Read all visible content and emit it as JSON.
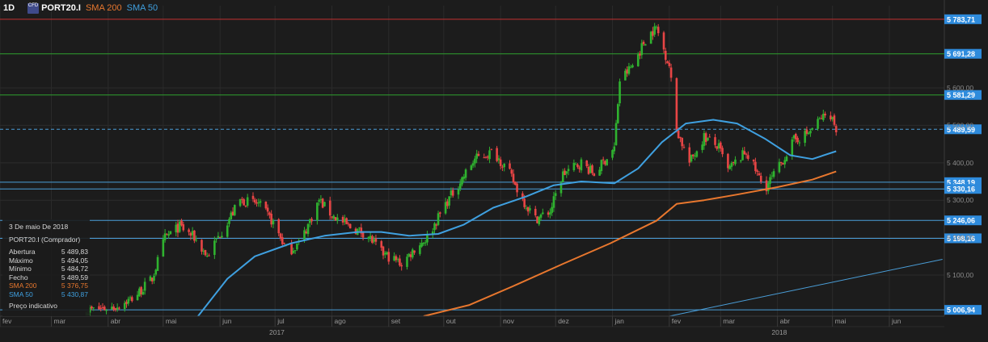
{
  "header": {
    "timeframe": "1D",
    "badge": "CFD",
    "symbol": "PORT20.I",
    "sma200_label": "SMA 200",
    "sma50_label": "SMA 50"
  },
  "colors": {
    "background": "#1c1c1c",
    "sma200": "#e8772e",
    "sma50": "#3fa0e0",
    "candle_up": "#2fb22f",
    "candle_down": "#e84545",
    "level_red": "#c43030",
    "level_green": "#2ea02e",
    "level_blue": "#4a9ed8",
    "label_bg": "#2e8bdc"
  },
  "info_panel": {
    "date": "3 De maio De 2018",
    "instrument": "PORT20.I (Comprador)",
    "open_label": "Abertura",
    "open": "5 489,83",
    "high_label": "Máximo",
    "high": "5 494,05",
    "low_label": "Mínimo",
    "low": "5 484,72",
    "close_label": "Fecho",
    "close": "5 489,59",
    "sma200_label": "SMA 200",
    "sma200": "5 376,75",
    "sma50_label": "SMA 50",
    "sma50": "5 430,87",
    "note": "Preço indicativo"
  },
  "chart_data": {
    "type": "candlestick",
    "symbol": "PORT20.I",
    "timeframe": "1D",
    "ylim": [
      4990,
      5820
    ],
    "y_ticks": [
      5100,
      5200,
      5300,
      5400,
      5500,
      5600
    ],
    "y_tick_labels": [
      "5 100,00",
      "5 200,00",
      "5 300,00",
      "5 400,00",
      "5 500,00",
      "5 600,00"
    ],
    "x_months": [
      "fev",
      "mar",
      "abr",
      "mai",
      "jun",
      "jul",
      "ago",
      "set",
      "out",
      "nov",
      "dez",
      "jan",
      "fev",
      "mar",
      "abr",
      "mai",
      "jun"
    ],
    "x_years": [
      "2017",
      "2018"
    ],
    "price_levels": [
      {
        "value": 5783.71,
        "label": "5 783,71",
        "color": "red"
      },
      {
        "value": 5691.28,
        "label": "5 691,28",
        "color": "green"
      },
      {
        "value": 5581.29,
        "label": "5 581,29",
        "color": "green"
      },
      {
        "value": 5489.59,
        "label": "5 489,59",
        "color": "blue",
        "style": "dashed"
      },
      {
        "value": 5348.19,
        "label": "5 348,19",
        "color": "blue"
      },
      {
        "value": 5330.16,
        "label": "5 330,16",
        "color": "blue"
      },
      {
        "value": 5246.06,
        "label": "5 246,06",
        "color": "blue"
      },
      {
        "value": 5198.16,
        "label": "5 198,16",
        "color": "blue"
      },
      {
        "value": 5006.94,
        "label": "5 006,94",
        "color": "blue"
      }
    ],
    "close_path": [
      [
        "2017-03-20",
        5005
      ],
      [
        "2017-04-05",
        5015
      ],
      [
        "2017-04-15",
        5040
      ],
      [
        "2017-04-25",
        5090
      ],
      [
        "2017-05-02",
        5200
      ],
      [
        "2017-05-10",
        5230
      ],
      [
        "2017-05-18",
        5200
      ],
      [
        "2017-05-25",
        5150
      ],
      [
        "2017-06-01",
        5210
      ],
      [
        "2017-06-12",
        5300
      ],
      [
        "2017-06-22",
        5290
      ],
      [
        "2017-06-30",
        5240
      ],
      [
        "2017-07-08",
        5160
      ],
      [
        "2017-07-15",
        5190
      ],
      [
        "2017-07-25",
        5300
      ],
      [
        "2017-08-01",
        5260
      ],
      [
        "2017-08-10",
        5230
      ],
      [
        "2017-08-20",
        5210
      ],
      [
        "2017-08-28",
        5160
      ],
      [
        "2017-09-08",
        5130
      ],
      [
        "2017-09-15",
        5170
      ],
      [
        "2017-09-22",
        5200
      ],
      [
        "2017-10-02",
        5290
      ],
      [
        "2017-10-10",
        5350
      ],
      [
        "2017-10-18",
        5410
      ],
      [
        "2017-10-28",
        5430
      ],
      [
        "2017-11-05",
        5380
      ],
      [
        "2017-11-12",
        5310
      ],
      [
        "2017-11-20",
        5250
      ],
      [
        "2017-11-28",
        5270
      ],
      [
        "2017-12-05",
        5370
      ],
      [
        "2017-12-15",
        5400
      ],
      [
        "2017-12-22",
        5370
      ],
      [
        "2018-01-02",
        5440
      ],
      [
        "2018-01-05",
        5620
      ],
      [
        "2018-01-12",
        5660
      ],
      [
        "2018-01-20",
        5740
      ],
      [
        "2018-01-25",
        5760
      ],
      [
        "2018-02-01",
        5660
      ],
      [
        "2018-02-05",
        5490
      ],
      [
        "2018-02-12",
        5400
      ],
      [
        "2018-02-20",
        5470
      ],
      [
        "2018-02-28",
        5440
      ],
      [
        "2018-03-05",
        5380
      ],
      [
        "2018-03-15",
        5430
      ],
      [
        "2018-03-25",
        5330
      ],
      [
        "2018-04-02",
        5390
      ],
      [
        "2018-04-10",
        5460
      ],
      [
        "2018-04-18",
        5480
      ],
      [
        "2018-04-25",
        5520
      ],
      [
        "2018-04-30",
        5530
      ],
      [
        "2018-05-03",
        5489.59
      ]
    ],
    "sma50_path": [
      [
        "2017-05-20",
        4990
      ],
      [
        "2017-06-05",
        5090
      ],
      [
        "2017-06-20",
        5150
      ],
      [
        "2017-07-10",
        5185
      ],
      [
        "2017-07-28",
        5205
      ],
      [
        "2017-08-15",
        5215
      ],
      [
        "2017-08-28",
        5215
      ],
      [
        "2017-09-12",
        5205
      ],
      [
        "2017-09-28",
        5210
      ],
      [
        "2017-10-12",
        5235
      ],
      [
        "2017-10-28",
        5280
      ],
      [
        "2017-11-15",
        5310
      ],
      [
        "2017-11-30",
        5340
      ],
      [
        "2017-12-15",
        5350
      ],
      [
        "2018-01-02",
        5345
      ],
      [
        "2018-01-15",
        5385
      ],
      [
        "2018-01-28",
        5455
      ],
      [
        "2018-02-10",
        5505
      ],
      [
        "2018-02-25",
        5515
      ],
      [
        "2018-03-10",
        5505
      ],
      [
        "2018-03-25",
        5465
      ],
      [
        "2018-04-08",
        5420
      ],
      [
        "2018-04-20",
        5410
      ],
      [
        "2018-05-03",
        5430.87
      ]
    ],
    "sma200_path": [
      [
        "2017-09-20",
        4990
      ],
      [
        "2017-10-15",
        5020
      ],
      [
        "2017-11-10",
        5075
      ],
      [
        "2017-12-05",
        5130
      ],
      [
        "2017-12-31",
        5185
      ],
      [
        "2018-01-25",
        5245
      ],
      [
        "2018-02-05",
        5290
      ],
      [
        "2018-02-20",
        5300
      ],
      [
        "2018-03-10",
        5315
      ],
      [
        "2018-04-01",
        5335
      ],
      [
        "2018-04-20",
        5355
      ],
      [
        "2018-05-03",
        5376.75
      ]
    ],
    "trend_lines": [
      {
        "color": "blue",
        "points": [
          [
            "2018-02-01",
            4990
          ],
          [
            "2018-06-30",
            5142
          ]
        ]
      }
    ]
  }
}
